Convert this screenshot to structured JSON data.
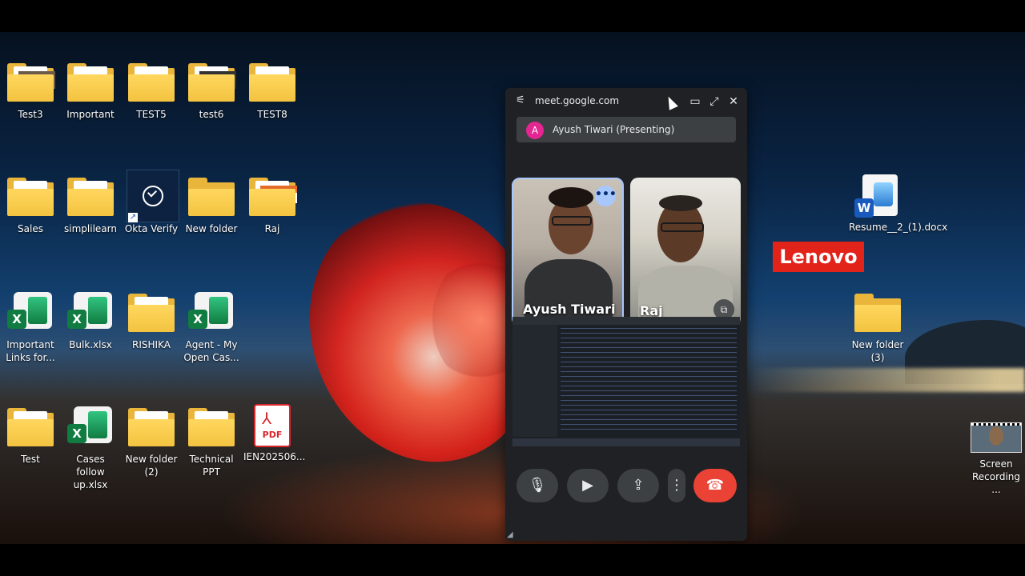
{
  "desktop": {
    "icons": [
      {
        "label": "Test3"
      },
      {
        "label": "Important"
      },
      {
        "label": "TEST5"
      },
      {
        "label": "test6"
      },
      {
        "label": "TEST8"
      },
      {
        "label": "Sales"
      },
      {
        "label": "simplilearn"
      },
      {
        "label": "Okta Verify"
      },
      {
        "label": "New folder"
      },
      {
        "label": "Raj"
      },
      {
        "label": "Important Links for..."
      },
      {
        "label": "Bulk.xlsx"
      },
      {
        "label": "RISHIKA"
      },
      {
        "label": "Agent - My Open Cas..."
      },
      {
        "label": "Test"
      },
      {
        "label": "Cases follow up.xlsx"
      },
      {
        "label": "New folder (2)"
      },
      {
        "label": "Technical PPT"
      },
      {
        "label": "IEN202506..."
      },
      {
        "label": "Resume__2_(1).docx"
      },
      {
        "label": "New folder (3)"
      },
      {
        "label": "Screen Recording ..."
      }
    ],
    "lenovo_logo": "Lenovo",
    "pdf_badge": "PDF",
    "excel_badge": "X",
    "word_badge": "W",
    "colors": {
      "folder": "#f3c340",
      "excel": "#107c41",
      "word": "#185abd",
      "pdf": "#d8262c",
      "lenovo": "#e2231a"
    }
  },
  "meet": {
    "url": "meet.google.com",
    "presenter_initial": "A",
    "presenter_label": "Ayush Tiwari (Presenting)",
    "participants": [
      {
        "name": "Ayush Tiwari"
      },
      {
        "name": "Raj"
      }
    ],
    "colors": {
      "end_call": "#ea4335",
      "active_border": "#a8c7fa",
      "avatar": "#e52592",
      "window": "#202124"
    }
  }
}
